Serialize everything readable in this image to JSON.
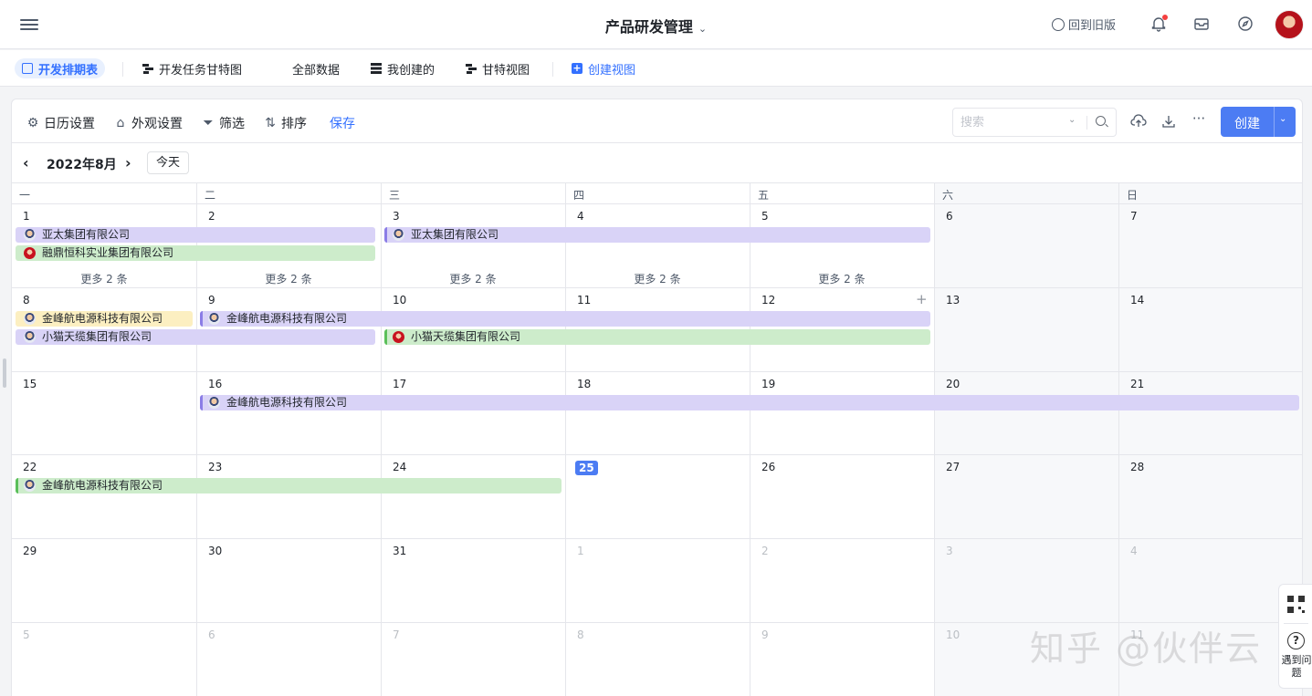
{
  "header": {
    "title": "产品研发管理",
    "back_label": "回到旧版"
  },
  "tabs": [
    {
      "label": "开发排期表",
      "icon": "calendar-icon",
      "active": true
    },
    {
      "label": "开发任务甘特图",
      "icon": "gantt-icon"
    },
    {
      "label": "全部数据",
      "icon": "grid-icon"
    },
    {
      "label": "我创建的",
      "icon": "table-icon"
    },
    {
      "label": "甘特视图",
      "icon": "gantt-icon"
    },
    {
      "label": "创建视图",
      "icon": "plus-icon"
    }
  ],
  "toolbar": {
    "calendar_settings": "日历设置",
    "appearance_settings": "外观设置",
    "filter": "筛选",
    "sort": "排序",
    "save": "保存",
    "search_placeholder": "搜索",
    "create": "创建"
  },
  "calendar": {
    "month_label": "2022年8月",
    "today_label": "今天",
    "weekdays": [
      "一",
      "二",
      "三",
      "四",
      "五",
      "六",
      "日"
    ],
    "more_label": "更多 2 条",
    "weeks": [
      [
        "1",
        "2",
        "3",
        "4",
        "5",
        "6",
        "7"
      ],
      [
        "8",
        "9",
        "10",
        "11",
        "12",
        "13",
        "14"
      ],
      [
        "15",
        "16",
        "17",
        "18",
        "19",
        "20",
        "21"
      ],
      [
        "22",
        "23",
        "24",
        "25",
        "26",
        "27",
        "28"
      ],
      [
        "29",
        "30",
        "31",
        "1",
        "2",
        "3",
        "4"
      ],
      [
        "5",
        "6",
        "7",
        "8",
        "9",
        "10",
        "11"
      ]
    ],
    "events": [
      {
        "label": "亚太集团有限公司",
        "color": "#d9d3f7"
      },
      {
        "label": "融鼎恒科实业集团有限公司",
        "color": "#cdeccb"
      },
      {
        "label": "亚太集团有限公司",
        "color": "#d9d3f7"
      },
      {
        "label": "金峰航电源科技有限公司",
        "color": "#fcefc1"
      },
      {
        "label": "小猫天缆集团有限公司",
        "color": "#d9d3f7"
      },
      {
        "label": "金峰航电源科技有限公司",
        "color": "#d9d3f7"
      },
      {
        "label": "小猫天缆集团有限公司",
        "color": "#cdeccb"
      },
      {
        "label": "金峰航电源科技有限公司",
        "color": "#d9d3f7"
      },
      {
        "label": "金峰航电源科技有限公司",
        "color": "#cdeccb"
      }
    ]
  },
  "watermark": "知乎 @伙伴云",
  "side_help": {
    "help_label": "遇到问题"
  },
  "colors": {
    "accent": "#3370ff",
    "today": "#4c7cf3",
    "event_purple": "#d9d3f7",
    "event_green": "#cdeccb",
    "event_yellow": "#fcefc1"
  }
}
